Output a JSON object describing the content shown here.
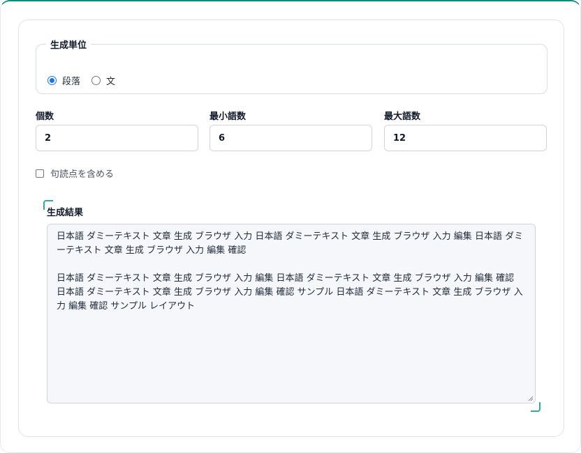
{
  "unit": {
    "legend": "生成単位",
    "options": [
      {
        "label": "段落",
        "checked": true
      },
      {
        "label": "文",
        "checked": false
      }
    ]
  },
  "fields": {
    "count": {
      "label": "個数",
      "value": "2"
    },
    "min_words": {
      "label": "最小語数",
      "value": "6"
    },
    "max_words": {
      "label": "最大語数",
      "value": "12"
    }
  },
  "punctuation": {
    "label": "句読点を含める",
    "checked": false
  },
  "result": {
    "label": "生成結果",
    "paragraphs": [
      "日本語 ダミーテキスト 文章 生成 ブラウザ 入力  日本語 ダミーテキスト 文章 生成 ブラウザ 入力 編集  日本語 ダミーテキスト 文章 生成 ブラウザ 入力 編集 確認",
      "日本語 ダミーテキスト 文章 生成 ブラウザ 入力 編集  日本語 ダミーテキスト 文章 生成 ブラウザ 入力 編集 確認  日本語 ダミーテキスト 文章 生成 ブラウザ 入力 編集 確認 サンプル  日本語 ダミーテキスト 文章 生成 ブラウザ 入力 編集 確認 サンプル レイアウト"
    ]
  },
  "colors": {
    "accent": "#0f8a7e",
    "radio": "#1a73e8",
    "result_bg": "#f6f7fb"
  }
}
